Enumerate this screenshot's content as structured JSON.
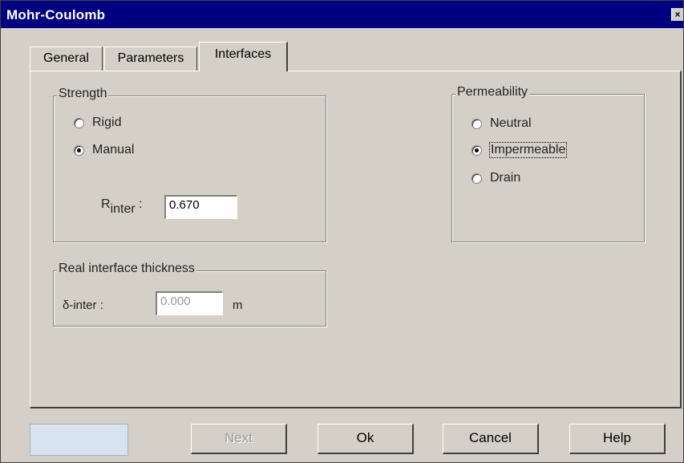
{
  "window": {
    "title": "Mohr-Coulomb",
    "close_glyph": "×"
  },
  "tabs": [
    {
      "label": "General"
    },
    {
      "label": "Parameters"
    },
    {
      "label": "Interfaces"
    }
  ],
  "active_tab": "Interfaces",
  "strength": {
    "title": "Strength",
    "options": [
      "Rigid",
      "Manual"
    ],
    "selected": "Manual",
    "rinter_label_main": "R",
    "rinter_label_sub": "inter",
    "rinter_colon": ":",
    "rinter_value": "0.670"
  },
  "permeability": {
    "title": "Permeability",
    "options": [
      "Neutral",
      "Impermeable",
      "Drain"
    ],
    "selected": "Impermeable"
  },
  "thickness": {
    "title": "Real interface thickness",
    "label": "δ-inter :",
    "value": "0.000",
    "unit": "m"
  },
  "buttons": {
    "next": "Next",
    "ok": "Ok",
    "cancel": "Cancel",
    "help": "Help"
  }
}
